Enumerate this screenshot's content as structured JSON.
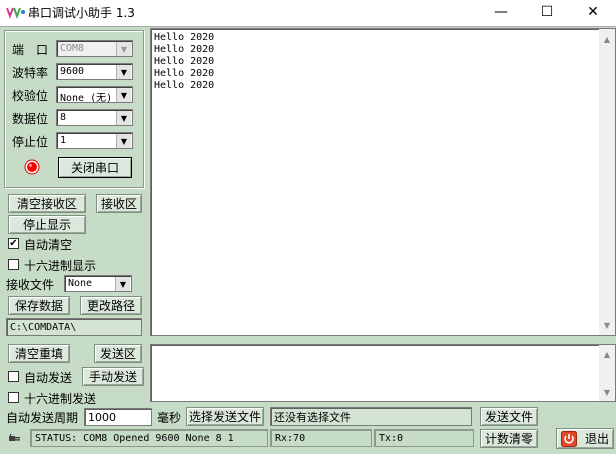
{
  "window": {
    "title": "串口调试小助手 1.3",
    "minimize_glyph": "—",
    "maximize_glyph": "☐",
    "close_glyph": "✕",
    "icon": "sscom-app-icon"
  },
  "port_settings": {
    "port_label": "端　口",
    "port_value": "COM8",
    "baud_label": "波特率",
    "baud_value": "9600",
    "parity_label": "校验位",
    "parity_value": "None (无)",
    "databits_label": "数据位",
    "databits_value": "8",
    "stopbits_label": "停止位",
    "stopbits_value": "1",
    "toggle_button": "关闭串口",
    "indicator_color": "#ff0000"
  },
  "receive": {
    "clear_button": "清空接收区",
    "area_button": "接收区",
    "stop_button": "停止显示",
    "auto_clear_label": "自动清空",
    "auto_clear_checked": true,
    "hex_display_label": "十六进制显示",
    "hex_display_checked": false,
    "file_label": "接收文件",
    "file_value": "None",
    "save_button": "保存数据",
    "change_path_button": "更改路径",
    "path": "C:\\COMDATA\\",
    "lines": [
      "Hello 2020",
      "Hello 2020",
      "Hello 2020",
      "Hello 2020",
      "Hello 2020"
    ]
  },
  "send": {
    "clear_button": "清空重填",
    "area_button": "发送区",
    "auto_send_label": "自动发送",
    "auto_send_checked": false,
    "manual_send_button": "手动发送",
    "hex_send_label": "十六进制发送",
    "hex_send_checked": false,
    "period_label": "自动发送周期",
    "period_value": "1000",
    "ms_label": "毫秒",
    "choose_file_button": "选择发送文件",
    "file_status": "还没有选择文件",
    "send_file_button": "发送文件",
    "reset_count_button": "计数清零",
    "exit_button": "退出"
  },
  "status": {
    "text": "STATUS: COM8 Opened 9600 None  8 1",
    "rx": "Rx:70",
    "tx": "Tx:0"
  }
}
